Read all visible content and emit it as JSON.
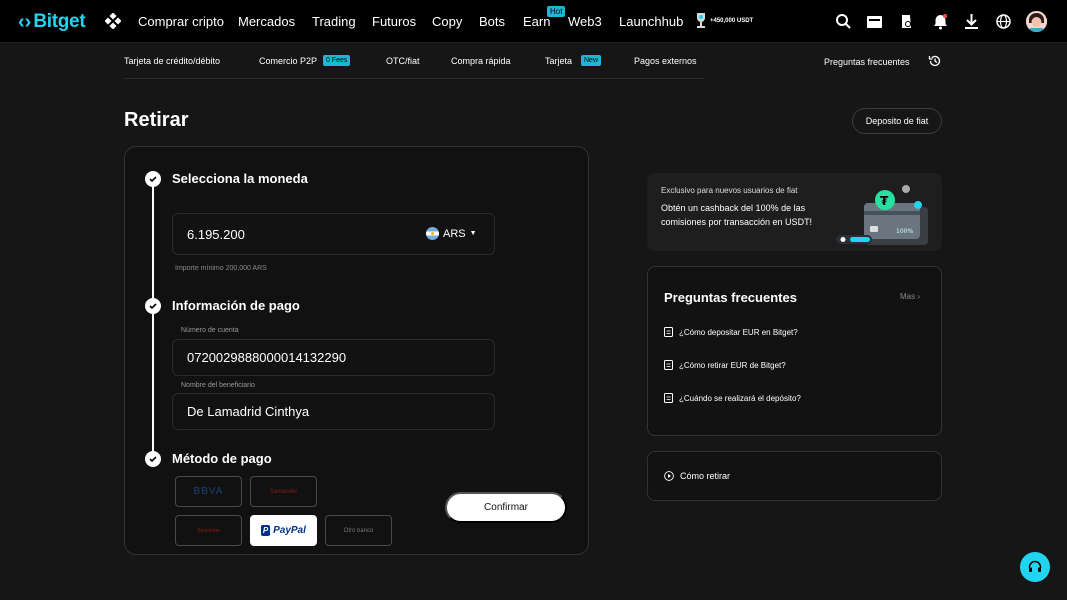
{
  "brand": {
    "name": "Bitget",
    "accent": "#22d4f0"
  },
  "topnav": {
    "items": [
      "Comprar cripto",
      "Mercados",
      "Trading",
      "Futuros",
      "Copy",
      "Bots",
      "Earn",
      "Web3",
      "Launchhub"
    ],
    "hot_badge": "Hot",
    "promo_text": "+450,000 USDT",
    "icons": [
      "search-icon",
      "wallet-icon",
      "orders-icon",
      "bell-icon",
      "download-icon",
      "globe-icon"
    ]
  },
  "subnav": {
    "items": [
      "Tarjeta de crédito/débito",
      "Comercio P2P",
      "OTC/fiat",
      "Compra rápida",
      "Tarjeta",
      "Pagos externos"
    ],
    "p2p_badge": "0 Fees",
    "card_badge": "New",
    "faq_link": "Preguntas frecuentes"
  },
  "page": {
    "title": "Retirar",
    "fiat_deposit_button": "Deposito de fiat"
  },
  "form": {
    "step1_title": "Selecciona la moneda",
    "amount_value": "6.195.200",
    "currency": "ARS",
    "min_hint": "Importe mínimo 200,000 ARS",
    "step2_title": "Información de pago",
    "account_label": "Número de cuenta",
    "account_value": "0720029888000014132290",
    "beneficiary_label": "Nombre del beneficiario",
    "beneficiary_value": "De Lamadrid Cinthya",
    "step3_title": "Método de pago",
    "payment_methods": [
      "BBVA",
      "Santander",
      "Santander",
      "PayPal",
      "Otro banco"
    ],
    "selected_method": "PayPal",
    "confirm_button": "Confirmar"
  },
  "promo": {
    "small": "Exclusivo para nuevos usuarios de fiat",
    "main": "Obtén un cashback del 100% de las comisiones por transacción en USDT!",
    "art_text": "100%"
  },
  "faq": {
    "title": "Preguntas frecuentes",
    "more": "Mas",
    "items": [
      "¿Cómo depositar EUR en Bitget?",
      "¿Cómo retirar EUR de Bitget?",
      "¿Cuándo se realizará el depósito?"
    ]
  },
  "howto": {
    "label": "Cómo retirar"
  }
}
